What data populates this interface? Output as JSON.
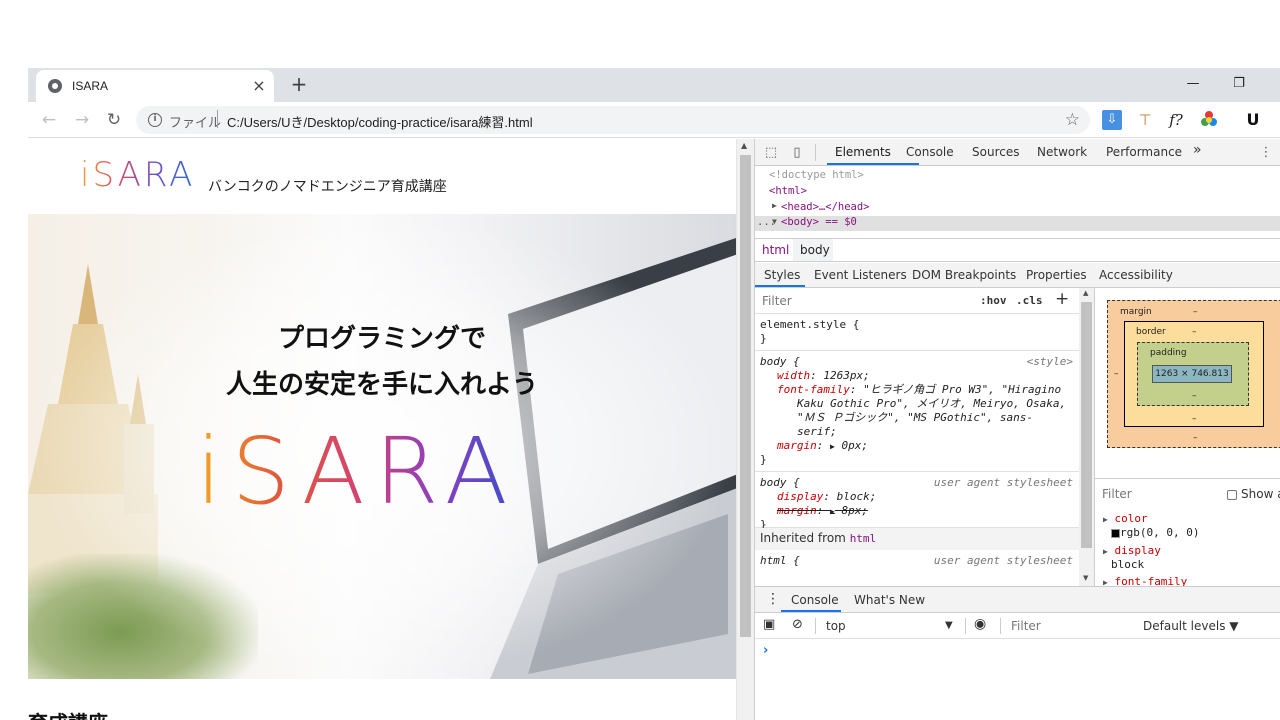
{
  "browser": {
    "tab": {
      "title": "ISARA",
      "close_glyph": "×"
    },
    "new_tab_glyph": "+",
    "window_controls": {
      "minimize": "—",
      "maximize": "❐"
    },
    "address": {
      "scheme": "ファイル",
      "url": "C:/Users/Uき/Desktop/coding-practice/isara練習.html"
    },
    "extensions": [
      "download-extension-icon",
      "stamp-extension-icon",
      "fx-extension-icon",
      "color-extension-icon",
      "u-extension-icon"
    ],
    "ext_fx": "f?",
    "ext_u": "U"
  },
  "page": {
    "logo": "iSARA",
    "tagline": "バンコクのノマドエンジニア育成講座",
    "hero_line1": "プログラミングで",
    "hero_line2": "人生の安定を手に入れよう",
    "hero_logo": "iSARA",
    "next_heading": "育成講座"
  },
  "devtools": {
    "tabs": [
      "Elements",
      "Console",
      "Sources",
      "Network",
      "Performance"
    ],
    "more": "»",
    "elements": {
      "doctype": "<!doctype html>",
      "html_open": "<html>",
      "head": "<head>…</head>",
      "body": "<body> == $0",
      "ellipsis": "..."
    },
    "breadcrumbs": [
      "html",
      "body"
    ],
    "subtabs": [
      "Styles",
      "Event Listeners",
      "DOM Breakpoints",
      "Properties",
      "Accessibility"
    ],
    "styles": {
      "filter_placeholder": "Filter",
      "hov": ":hov",
      "cls": ".cls",
      "add": "+",
      "element_style": "element.style {",
      "close_brace": "}",
      "rule1_selector": "body {",
      "rule1_source": "<style>",
      "rule1_width_name": "width",
      "rule1_width_value": "1263px;",
      "rule1_ff_name": "font-family",
      "rule1_ff_value1": "\"ヒラギノ角ゴ Pro W3\", \"Hiragino",
      "rule1_ff_value2": "Kaku Gothic Pro\", メイリオ, Meiryo, Osaka,",
      "rule1_ff_value3": "\"ＭＳ Ｐゴシック\", \"MS PGothic\", sans-",
      "rule1_ff_value4": "serif;",
      "rule1_margin_name": "margin",
      "rule1_margin_value": "0px;",
      "rule2_selector": "body {",
      "rule2_source": "user agent stylesheet",
      "rule2_display_name": "display",
      "rule2_display_value": "block;",
      "rule2_margin_name": "margin",
      "rule2_margin_value": "8px;",
      "inherited_label": "Inherited from",
      "inherited_tag": "html",
      "rule3_selector": "html {",
      "rule3_source": "user agent stylesheet"
    },
    "box_model": {
      "margin_label": "margin",
      "border_label": "border",
      "padding_label": "padding",
      "dash": "–",
      "content_size": "1263 × 746.813"
    },
    "computed": {
      "filter_placeholder": "Filter",
      "show_all": "Show all",
      "color_name": "color",
      "color_value": "rgb(0, 0, 0)",
      "display_name": "display",
      "display_value": "block",
      "font_family_name": "font-family"
    },
    "drawer": {
      "tabs": [
        "Console",
        "What's New"
      ],
      "context": "top",
      "filter_placeholder": "Filter",
      "levels": "Default levels ▼",
      "prompt": "›"
    }
  },
  "colors": {
    "accent": "#1a73e8",
    "tag": "#881280",
    "prop": "#c80000"
  }
}
